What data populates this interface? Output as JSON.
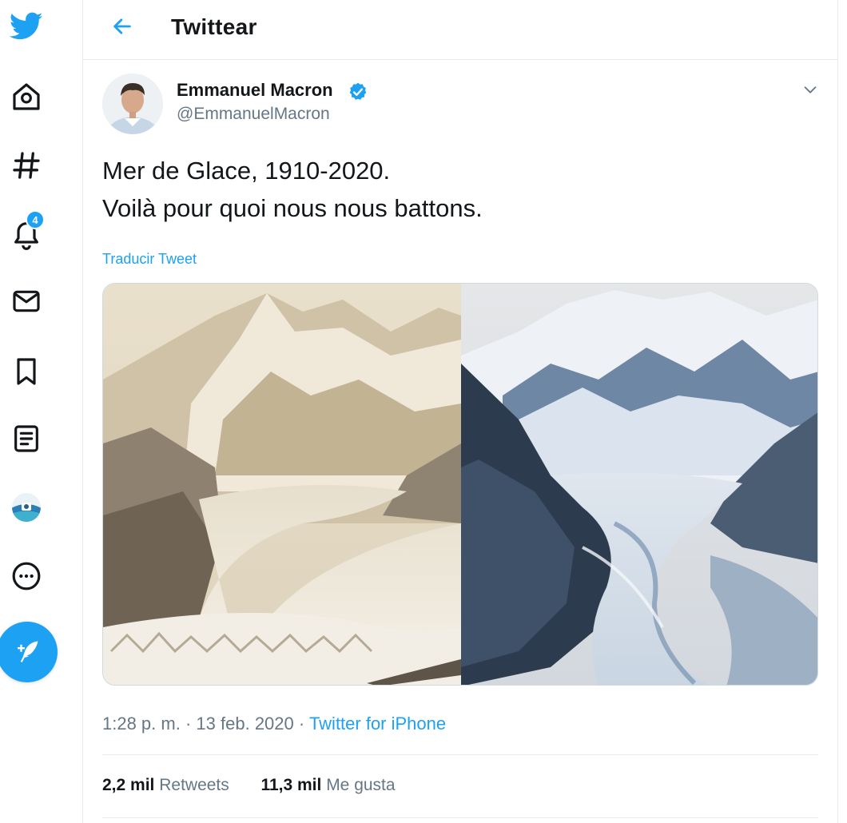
{
  "app": {
    "accent_color": "#1da1f2"
  },
  "sidebar": {
    "items": [
      {
        "icon": "twitter-bird-icon"
      },
      {
        "icon": "home-icon"
      },
      {
        "icon": "hashtag-icon"
      },
      {
        "icon": "notifications-bell-icon",
        "badge": "4"
      },
      {
        "icon": "messages-envelope-icon"
      },
      {
        "icon": "bookmark-icon"
      },
      {
        "icon": "lists-icon"
      },
      {
        "icon": "profile-avatar-icon"
      },
      {
        "icon": "more-options-icon"
      }
    ],
    "compose_icon": "compose-tweet-icon"
  },
  "header": {
    "back_icon": "back-arrow-icon",
    "title": "Twittear"
  },
  "tweet": {
    "author": {
      "name": "Emmanuel Macron",
      "handle": "@EmmanuelMacron",
      "verified": true
    },
    "text_lines": [
      "Mer de Glace, 1910-2020.",
      "Voilà pour quoi nous nous battons."
    ],
    "translate_label": "Traducir Tweet",
    "media_icon": "glacier-photo-comparison",
    "time": "1:28 p. m.",
    "dot": "·",
    "date": "13 feb. 2020",
    "source": "Twitter for iPhone",
    "retweets_count": "2,2 mil",
    "retweets_label": "Retweets",
    "likes_count": "11,3 mil",
    "likes_label": "Me gusta"
  }
}
